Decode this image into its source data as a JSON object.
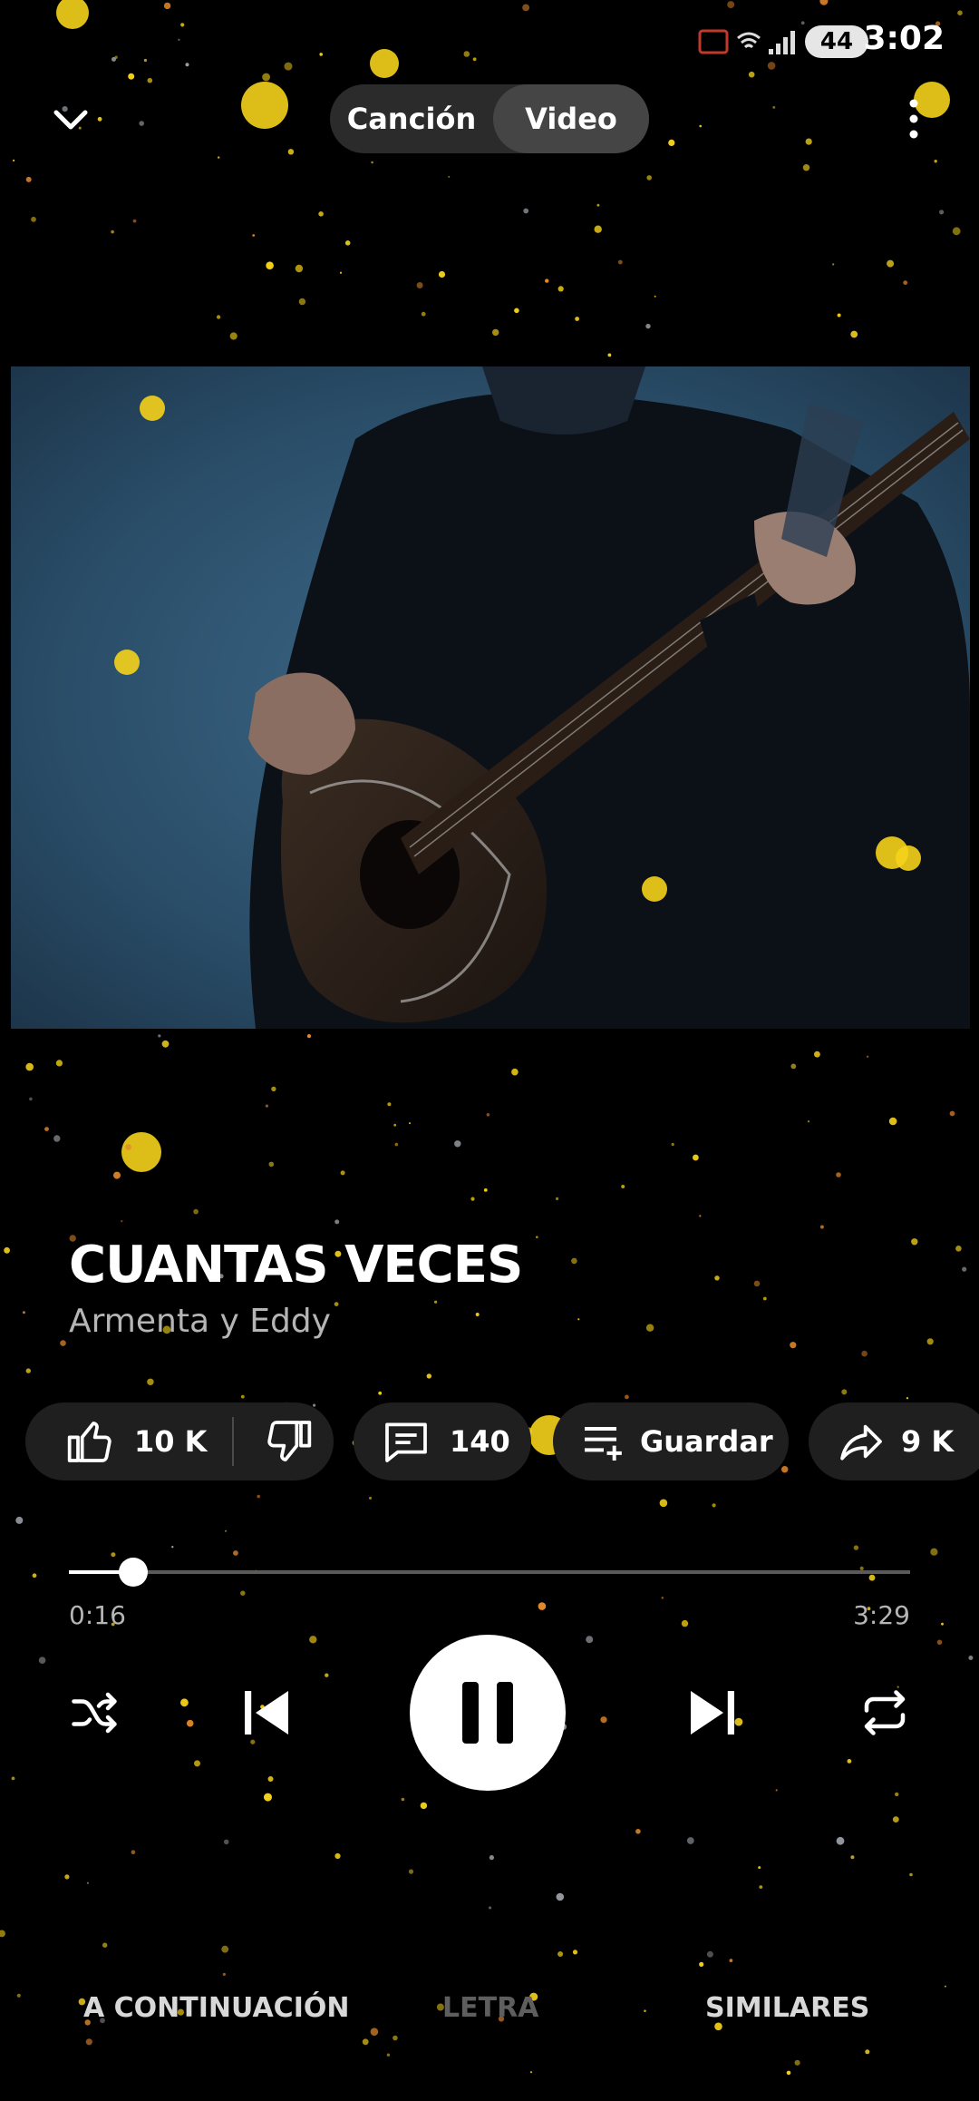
{
  "status_bar": {
    "time": "3:02",
    "battery": "44"
  },
  "top_bar": {
    "toggle_song": "Canción",
    "toggle_video": "Video",
    "selected": "Video"
  },
  "song": {
    "title": "CUANTAS VECES",
    "artist": "Armenta y Eddy"
  },
  "actions": {
    "likes": "10 K",
    "comments": "140",
    "save_label": "Guardar",
    "shares": "9 K"
  },
  "playback": {
    "elapsed": "0:16",
    "total": "3:29",
    "progress": 0.0766,
    "state": "playing"
  },
  "tabs": {
    "up_next": "A CONTINUACIÓN",
    "lyrics": "LETRA",
    "related": "SIMILARES"
  },
  "icons": {
    "collapse": "chevron-down-icon",
    "menu": "more-vert-icon",
    "like": "thumbs-up-icon",
    "dislike": "thumbs-down-icon",
    "comments": "comment-icon",
    "save": "playlist-add-icon",
    "share": "share-icon",
    "shuffle": "shuffle-icon",
    "previous": "skip-previous-icon",
    "pause": "pause-icon",
    "next": "skip-next-icon",
    "repeat": "repeat-icon"
  },
  "colors": {
    "background": "#000000",
    "accent": "#ffffff",
    "pill": "#1f1f1f",
    "sparkle": "#f5d21a"
  }
}
